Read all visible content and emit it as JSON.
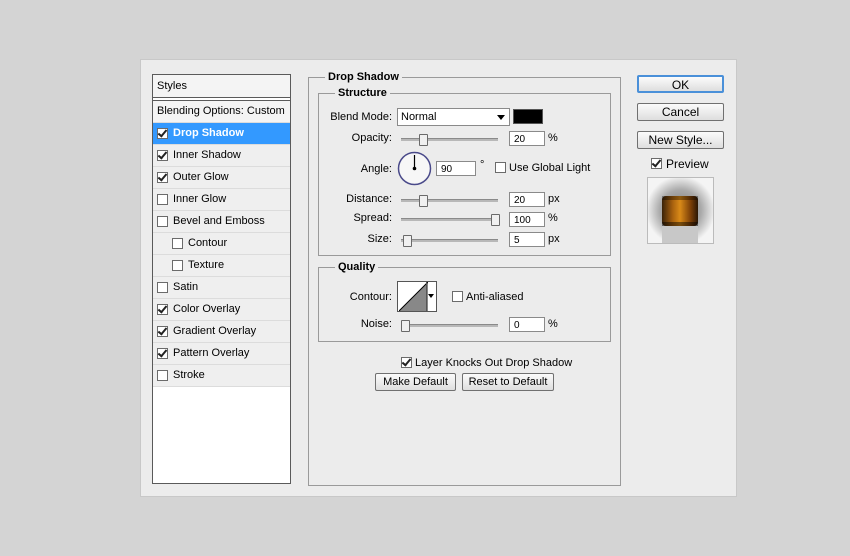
{
  "styles": {
    "header": "Styles",
    "blending": "Blending Options: Custom",
    "items": [
      {
        "label": "Drop Shadow",
        "checked": true,
        "selected": true,
        "sub": false
      },
      {
        "label": "Inner Shadow",
        "checked": true,
        "selected": false,
        "sub": false
      },
      {
        "label": "Outer Glow",
        "checked": true,
        "selected": false,
        "sub": false
      },
      {
        "label": "Inner Glow",
        "checked": false,
        "selected": false,
        "sub": false
      },
      {
        "label": "Bevel and Emboss",
        "checked": false,
        "selected": false,
        "sub": false
      },
      {
        "label": "Contour",
        "checked": false,
        "selected": false,
        "sub": true
      },
      {
        "label": "Texture",
        "checked": false,
        "selected": false,
        "sub": true
      },
      {
        "label": "Satin",
        "checked": false,
        "selected": false,
        "sub": false
      },
      {
        "label": "Color Overlay",
        "checked": true,
        "selected": false,
        "sub": false
      },
      {
        "label": "Gradient Overlay",
        "checked": true,
        "selected": false,
        "sub": false
      },
      {
        "label": "Pattern Overlay",
        "checked": true,
        "selected": false,
        "sub": false
      },
      {
        "label": "Stroke",
        "checked": false,
        "selected": false,
        "sub": false
      }
    ]
  },
  "drop_shadow": {
    "title": "Drop Shadow",
    "structure": {
      "title": "Structure",
      "blend_mode_label": "Blend Mode:",
      "blend_mode_value": "Normal",
      "shadow_color": "#000000",
      "opacity_label": "Opacity:",
      "opacity_value": "20",
      "opacity_unit": "%",
      "opacity_fraction": 0.2,
      "angle_label": "Angle:",
      "angle_value": "90",
      "angle_unit": "°",
      "use_global_light_label": "Use Global Light",
      "use_global_light_checked": false,
      "distance_label": "Distance:",
      "distance_value": "20",
      "distance_unit": "px",
      "distance_fraction": 0.2,
      "spread_label": "Spread:",
      "spread_value": "100",
      "spread_unit": "%",
      "spread_fraction": 1.0,
      "size_label": "Size:",
      "size_value": "5",
      "size_unit": "px",
      "size_fraction": 0.02
    },
    "quality": {
      "title": "Quality",
      "contour_label": "Contour:",
      "anti_aliased_label": "Anti-aliased",
      "anti_aliased_checked": false,
      "noise_label": "Noise:",
      "noise_value": "0",
      "noise_unit": "%",
      "noise_fraction": 0.0
    },
    "knocks_out_label": "Layer Knocks Out Drop Shadow",
    "knocks_out_checked": true,
    "make_default_label": "Make Default",
    "reset_default_label": "Reset to Default"
  },
  "buttons": {
    "ok": "OK",
    "cancel": "Cancel",
    "new_style": "New Style...",
    "preview_label": "Preview",
    "preview_checked": true
  },
  "colors": {
    "selection": "#3399ff",
    "ok_border": "#4a90d9"
  }
}
